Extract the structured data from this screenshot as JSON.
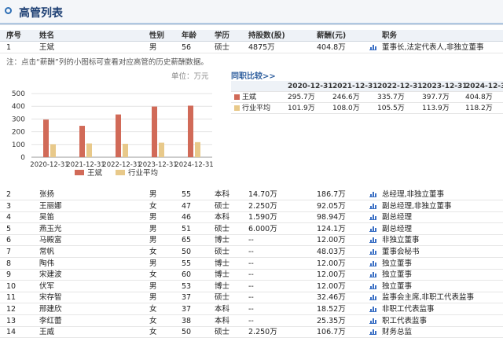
{
  "header": {
    "title": "高管列表"
  },
  "table": {
    "columns": [
      "序号",
      "姓名",
      "性别",
      "年龄",
      "学历",
      "持股数(股)",
      "薪酬(元)",
      "职务"
    ],
    "first_row": [
      "1",
      "王斌",
      "男",
      "56",
      "硕士",
      "4875万",
      "404.8万",
      "董事长,法定代表人,非独立董事"
    ]
  },
  "note": "注：点击“薪酬”列的小图标可查看对应高管的历史薪酬数据。",
  "chart_data": {
    "type": "bar",
    "categories": [
      "2020-12-31",
      "2021-12-31",
      "2022-12-31",
      "2023-12-31",
      "2024-12-31"
    ],
    "series": [
      {
        "name": "王斌",
        "values": [
          295.7,
          246.6,
          335.7,
          397.7,
          404.8
        ],
        "color": "#d16a58"
      },
      {
        "name": "行业平均",
        "values": [
          101.9,
          108.0,
          105.5,
          113.9,
          118.2
        ],
        "color": "#e8c98a"
      }
    ],
    "unit_label": "单位：万元",
    "ylim": [
      0,
      500
    ],
    "yticks": [
      "0",
      "100",
      "200",
      "300",
      "400",
      "500"
    ],
    "legend_position": "bottom"
  },
  "compare": {
    "title": "同职比较>>",
    "years": [
      "2020-12-31",
      "2021-12-31",
      "2022-12-31",
      "2023-12-31",
      "2024-12-31"
    ],
    "rows": [
      {
        "name": "王斌",
        "color": "#d16a58",
        "values": [
          "295.7万",
          "246.6万",
          "335.7万",
          "397.7万",
          "404.8万"
        ]
      },
      {
        "name": "行业平均",
        "color": "#e8c98a",
        "values": [
          "101.9万",
          "108.0万",
          "105.5万",
          "113.9万",
          "118.2万"
        ]
      }
    ]
  },
  "people": [
    [
      "2",
      "张扬",
      "男",
      "55",
      "本科",
      "14.70万",
      "186.7万",
      "总经理,非独立董事"
    ],
    [
      "3",
      "王丽娜",
      "女",
      "47",
      "硕士",
      "2.250万",
      "92.05万",
      "副总经理,非独立董事"
    ],
    [
      "4",
      "吴笛",
      "男",
      "46",
      "本科",
      "1.590万",
      "98.94万",
      "副总经理"
    ],
    [
      "5",
      "燕玉光",
      "男",
      "51",
      "硕士",
      "6.000万",
      "124.1万",
      "副总经理"
    ],
    [
      "6",
      "马殿富",
      "男",
      "65",
      "博士",
      "--",
      "12.00万",
      "非独立董事"
    ],
    [
      "7",
      "常帆",
      "女",
      "50",
      "硕士",
      "--",
      "48.03万",
      "董事会秘书"
    ],
    [
      "8",
      "陶伟",
      "男",
      "55",
      "博士",
      "--",
      "12.00万",
      "独立董事"
    ],
    [
      "9",
      "宋建波",
      "女",
      "60",
      "博士",
      "--",
      "12.00万",
      "独立董事"
    ],
    [
      "10",
      "伏军",
      "男",
      "53",
      "博士",
      "--",
      "12.00万",
      "独立董事"
    ],
    [
      "11",
      "宋存智",
      "男",
      "37",
      "硕士",
      "--",
      "32.46万",
      "监事会主席,非职工代表监事"
    ],
    [
      "12",
      "邢建欣",
      "女",
      "37",
      "本科",
      "--",
      "18.52万",
      "非职工代表监事"
    ],
    [
      "13",
      "李红蕾",
      "女",
      "38",
      "本科",
      "--",
      "25.35万",
      "职工代表监事"
    ],
    [
      "14",
      "王威",
      "女",
      "50",
      "硕士",
      "2.250万",
      "106.7万",
      "财务总监"
    ]
  ]
}
